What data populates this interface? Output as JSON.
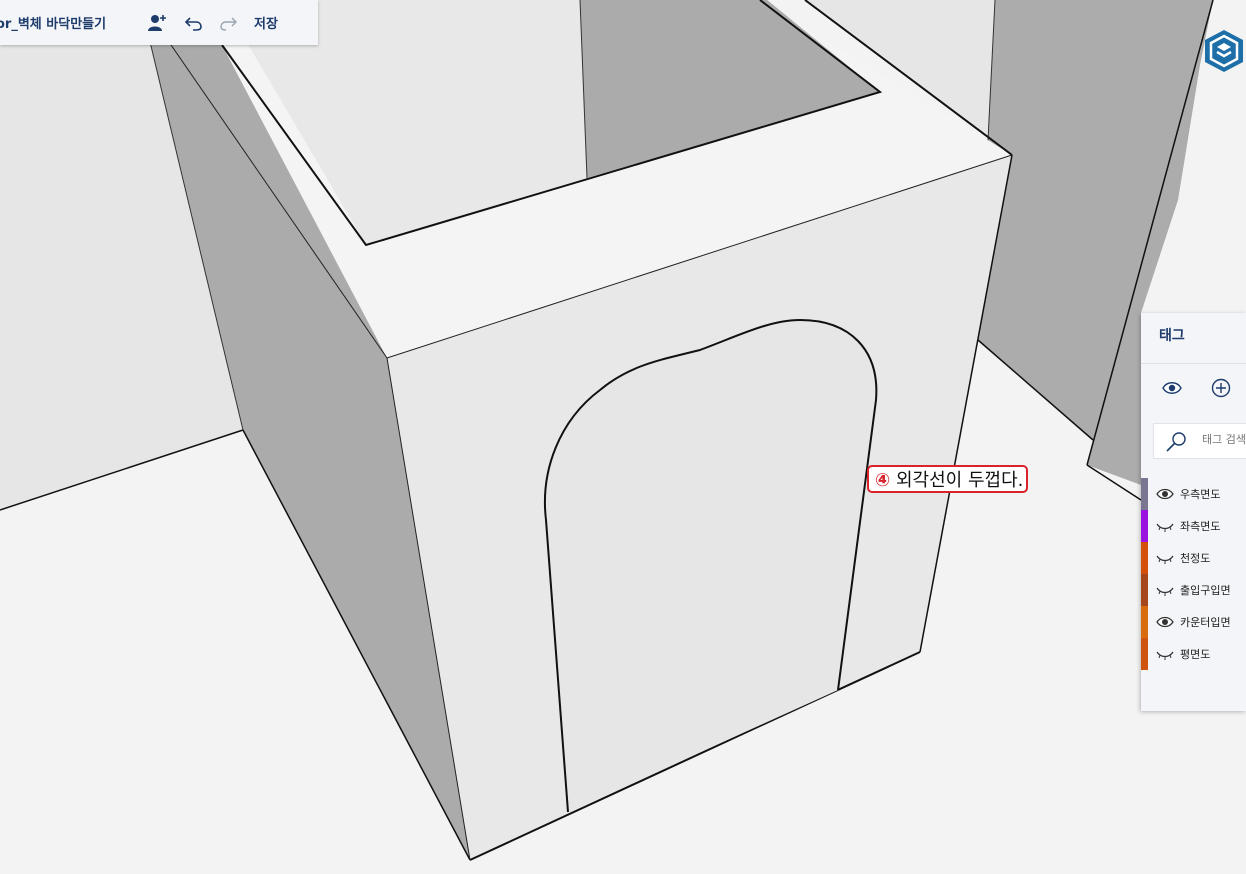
{
  "toolbar": {
    "document_title": "or_벽체 바닥만들기",
    "add_user_icon": "add-person-icon",
    "undo_icon": "undo-icon",
    "redo_icon": "redo-icon",
    "save_label": "저장"
  },
  "logo": {
    "name": "sketchup-logo",
    "color": "#1e6fa8"
  },
  "callout": {
    "number": "④",
    "text": "외각선이 두껍다.",
    "border_color": "#d9232a"
  },
  "tags_panel": {
    "title": "태그",
    "visibility_icon": "eye-icon",
    "add_icon": "add-circle-icon",
    "search_icon": "search-icon",
    "search_placeholder": "태그 검색",
    "tags": [
      {
        "name": "우측면도",
        "visible": true,
        "color": "#7a7590"
      },
      {
        "name": "좌측면도",
        "visible": false,
        "color": "#9a12e0"
      },
      {
        "name": "천정도",
        "visible": false,
        "color": "#d4500a"
      },
      {
        "name": "출입구입면",
        "visible": false,
        "color": "#a5461b"
      },
      {
        "name": "카운터입면",
        "visible": true,
        "color": "#d76b0e"
      },
      {
        "name": "평면도",
        "visible": false,
        "color": "#cf5410"
      }
    ]
  }
}
